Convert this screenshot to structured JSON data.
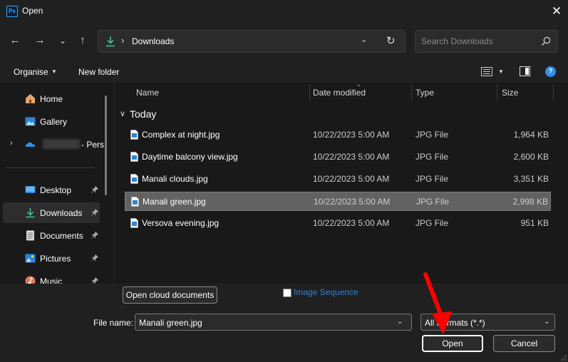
{
  "window": {
    "title": "Open",
    "app_icon_text": "Ps"
  },
  "nav": {
    "back": "←",
    "forward": "→",
    "recent": "⌄",
    "up": "↑",
    "address_path": "Downloads",
    "search_placeholder": "Search Downloads"
  },
  "commands": {
    "organise": "Organise",
    "new_folder": "New folder",
    "help": "?"
  },
  "sidebar": {
    "items": [
      {
        "label": "Home",
        "icon": "home-icon"
      },
      {
        "label": "Gallery",
        "icon": "gallery-icon"
      },
      {
        "label": "- Pers",
        "icon": "onedrive-icon"
      },
      {
        "label": "Desktop",
        "icon": "desktop-icon",
        "pinned": true
      },
      {
        "label": "Downloads",
        "icon": "download-icon",
        "pinned": true,
        "selected": true
      },
      {
        "label": "Documents",
        "icon": "documents-icon",
        "pinned": true
      },
      {
        "label": "Pictures",
        "icon": "pictures-icon",
        "pinned": true
      },
      {
        "label": "Music",
        "icon": "music-icon",
        "pinned": true
      }
    ]
  },
  "columns": {
    "name": "Name",
    "date": "Date modified",
    "type": "Type",
    "size": "Size"
  },
  "group": {
    "label": "Today"
  },
  "files": [
    {
      "name": "Complex at night.jpg",
      "date": "10/22/2023 5:00 AM",
      "type": "JPG File",
      "size": "1,964 KB"
    },
    {
      "name": "Daytime balcony view.jpg",
      "date": "10/22/2023 5:00 AM",
      "type": "JPG File",
      "size": "2,600 KB"
    },
    {
      "name": "Manali clouds.jpg",
      "date": "10/22/2023 5:00 AM",
      "type": "JPG File",
      "size": "3,351 KB"
    },
    {
      "name": "Manali green.jpg",
      "date": "10/22/2023 5:00 AM",
      "type": "JPG File",
      "size": "2,998 KB",
      "selected": true
    },
    {
      "name": "Versova evening.jpg",
      "date": "10/22/2023 5:00 AM",
      "type": "JPG File",
      "size": "951 KB"
    }
  ],
  "footer": {
    "cloud_button": "Open cloud documents",
    "image_sequence": "Image Sequence",
    "file_name_label": "File name:",
    "file_name_value": "Manali green.jpg",
    "filter_value": "All Formats (*.*)",
    "open_button": "Open",
    "cancel_button": "Cancel"
  },
  "colors": {
    "accent": "#2f8fe6",
    "download_green": "#3ec285",
    "arrow_red": "#ff0000"
  }
}
